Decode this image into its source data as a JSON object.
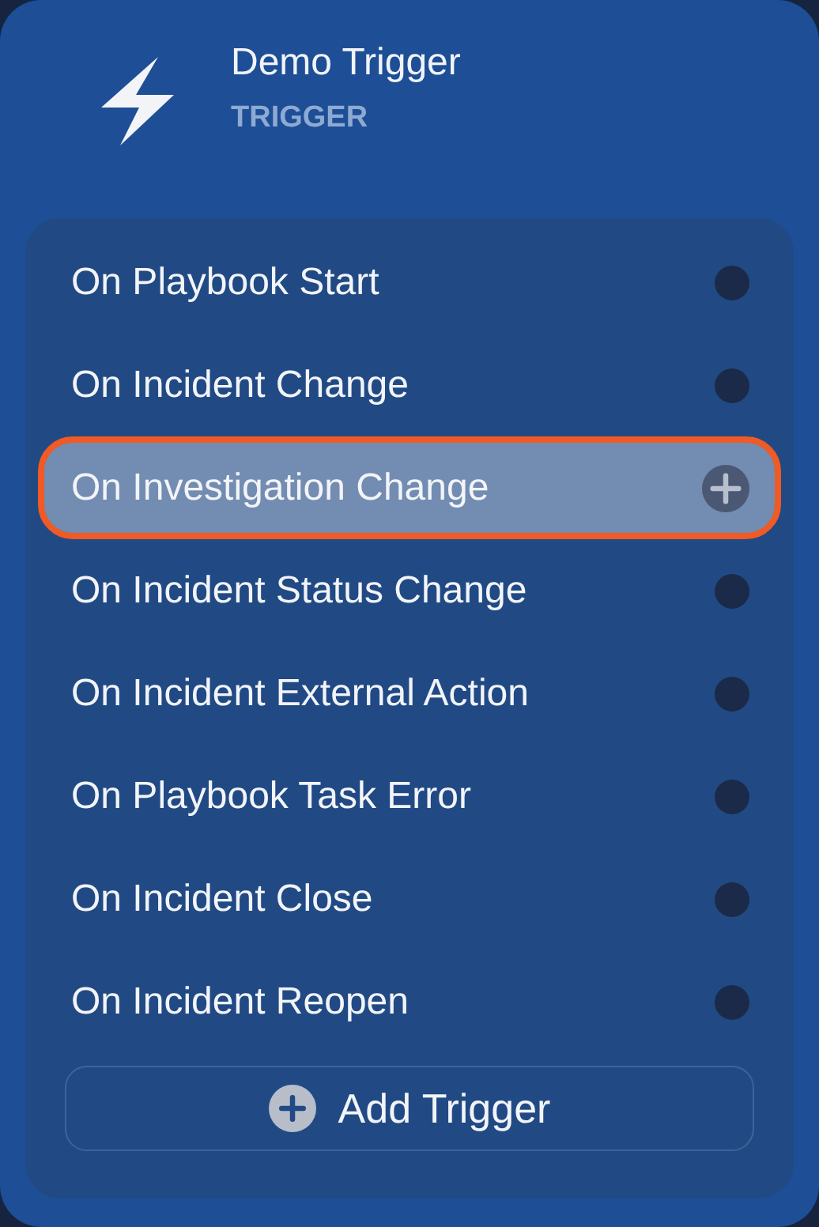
{
  "header": {
    "title": "Demo Trigger",
    "subtitle": "TRIGGER"
  },
  "triggers": [
    {
      "label": "On Playbook Start",
      "selected": false
    },
    {
      "label": "On Incident Change",
      "selected": false
    },
    {
      "label": "On Investigation Change",
      "selected": true
    },
    {
      "label": "On Incident Status Change",
      "selected": false
    },
    {
      "label": "On Incident External Action",
      "selected": false
    },
    {
      "label": "On Playbook Task Error",
      "selected": false
    },
    {
      "label": "On Incident Close",
      "selected": false
    },
    {
      "label": "On Incident Reopen",
      "selected": false
    }
  ],
  "add_button": {
    "label": "Add Trigger"
  }
}
